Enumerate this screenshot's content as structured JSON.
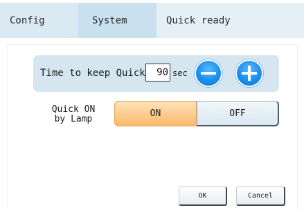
{
  "tabs": [
    {
      "label": "Config"
    },
    {
      "label": "System"
    },
    {
      "label": "Quick ready"
    }
  ],
  "quick_time": {
    "label": "Time to keep Quick",
    "value": "90",
    "unit": "sec",
    "decrease_icon": "minus-icon",
    "increase_icon": "plus-icon"
  },
  "quick_lamp": {
    "label_line1": "Quick ON",
    "label_line2": "by Lamp",
    "on_label": "ON",
    "off_label": "OFF",
    "selected": "ON"
  },
  "actions": {
    "ok_label": "OK",
    "cancel_label": "Cancel"
  },
  "colors": {
    "tab_config": "#dbe9f2",
    "tab_system": "#c9e0ee",
    "tab_quick": "#e5f0f6",
    "time_box": "#d5e6f0",
    "round_button": "#1a8ff0",
    "toggle_selected": "#f9b96a",
    "toggle_unselected": "#d9e7f1"
  }
}
